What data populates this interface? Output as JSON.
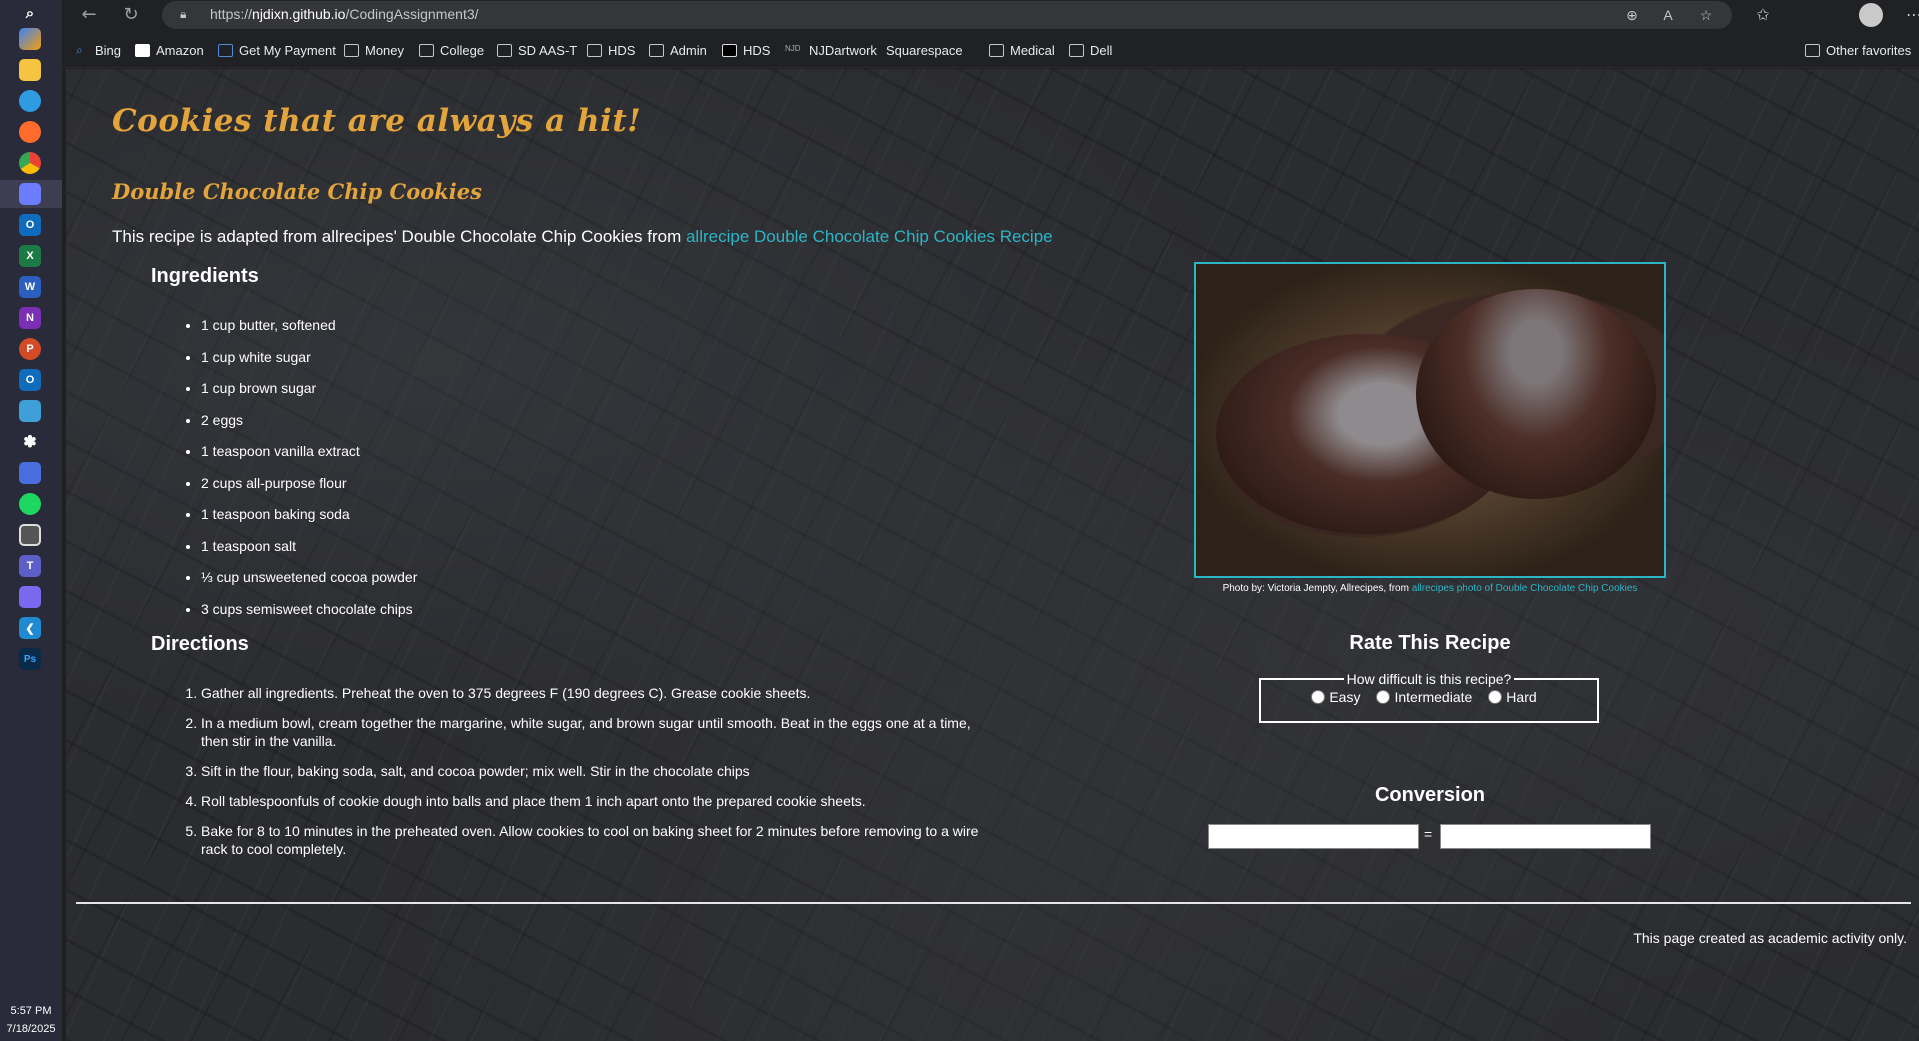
{
  "taskbar": {
    "icons": [
      "search-icon",
      "copilot-icon",
      "file-explorer-icon",
      "edge-icon",
      "firefox-icon",
      "chrome-icon",
      "app-icon",
      "outlook-icon",
      "excel-icon",
      "word-icon",
      "onenote-icon",
      "powerpoint-icon",
      "outlook-classic-icon",
      "defender-icon",
      "puzzle-icon",
      "calendar-icon",
      "spotify-icon",
      "camera-icon",
      "teams-icon",
      "teams-classic-icon",
      "vscode-icon",
      "photoshop-icon"
    ],
    "time": "5:57 PM",
    "date": "7/18/2025"
  },
  "browser": {
    "url_prefix": "https://",
    "url_host": "njdixn.github.io",
    "url_path": "/CodingAssignment3/",
    "bookmarks": [
      {
        "label": "Bing",
        "icon": "bing-icon"
      },
      {
        "label": "Amazon",
        "icon": "amazon-icon"
      },
      {
        "label": "Get My Payment",
        "icon": "payment-icon"
      },
      {
        "label": "Money",
        "icon": "folder-icon"
      },
      {
        "label": "College",
        "icon": "folder-icon"
      },
      {
        "label": "SD AAS-T",
        "icon": "folder-icon"
      },
      {
        "label": "HDS",
        "icon": "folder-icon"
      },
      {
        "label": "Admin",
        "icon": "folder-icon"
      },
      {
        "label": "HDS",
        "icon": "hds-icon"
      },
      {
        "label": "NJDartwork",
        "icon": "njd-icon"
      },
      {
        "label": "Squarespace",
        "icon": "squarespace-icon"
      },
      {
        "label": "Medical",
        "icon": "folder-icon"
      },
      {
        "label": "Dell",
        "icon": "folder-icon"
      }
    ],
    "other_favorites": "Other favorites"
  },
  "page": {
    "title": "Cookies that are always a hit!",
    "subtitle": "Double Chocolate Chip Cookies",
    "intro_text": "This recipe is adapted from allrecipes' Double Chocolate Chip Cookies from ",
    "intro_link": "allrecipe Double Chocolate Chip Cookies Recipe",
    "ingredients_heading": "Ingredients",
    "ingredients": [
      "1 cup butter, softened",
      "1 cup white sugar",
      "1 cup brown sugar",
      "2 eggs",
      "1 teaspoon vanilla extract",
      "2 cups all-purpose flour",
      "1 teaspoon baking soda",
      "1 teaspoon salt",
      "⅓ cup unsweetened cocoa powder",
      "3 cups semisweet chocolate chips"
    ],
    "directions_heading": "Directions",
    "directions": [
      "Gather all ingredients. Preheat the oven to 375 degrees F (190 degrees C). Grease cookie sheets.",
      "In a medium bowl, cream together the margarine, white sugar, and brown sugar until smooth. Beat in the eggs one at a time, then stir in the vanilla.",
      "Sift in the flour, baking soda, salt, and cocoa powder; mix well. Stir in the chocolate chips",
      "Roll tablespoonfuls of cookie dough into balls and place them 1 inch apart onto the prepared cookie sheets.",
      "Bake for 8 to 10 minutes in the preheated oven. Allow cookies to cool on baking sheet for 2 minutes before removing to a wire rack to cool completely."
    ],
    "photo_caption_text": "Photo by: Victoria Jempty, Allrecipes, from ",
    "photo_caption_link": "allrecipes photo of Double Chocolate Chip Cookies",
    "rate_heading": "Rate This Recipe",
    "difficulty_legend": "How difficult is this recipe?",
    "difficulty_options": [
      "Easy",
      "Intermediate",
      "Hard"
    ],
    "conversion_heading": "Conversion",
    "conversion_equals": "=",
    "conversion_left_value": "",
    "conversion_right_value": "",
    "footer": "This page created as academic activity only."
  },
  "colors": {
    "heading_gold": "#e3a43b",
    "link_teal": "#2cb5c6"
  }
}
